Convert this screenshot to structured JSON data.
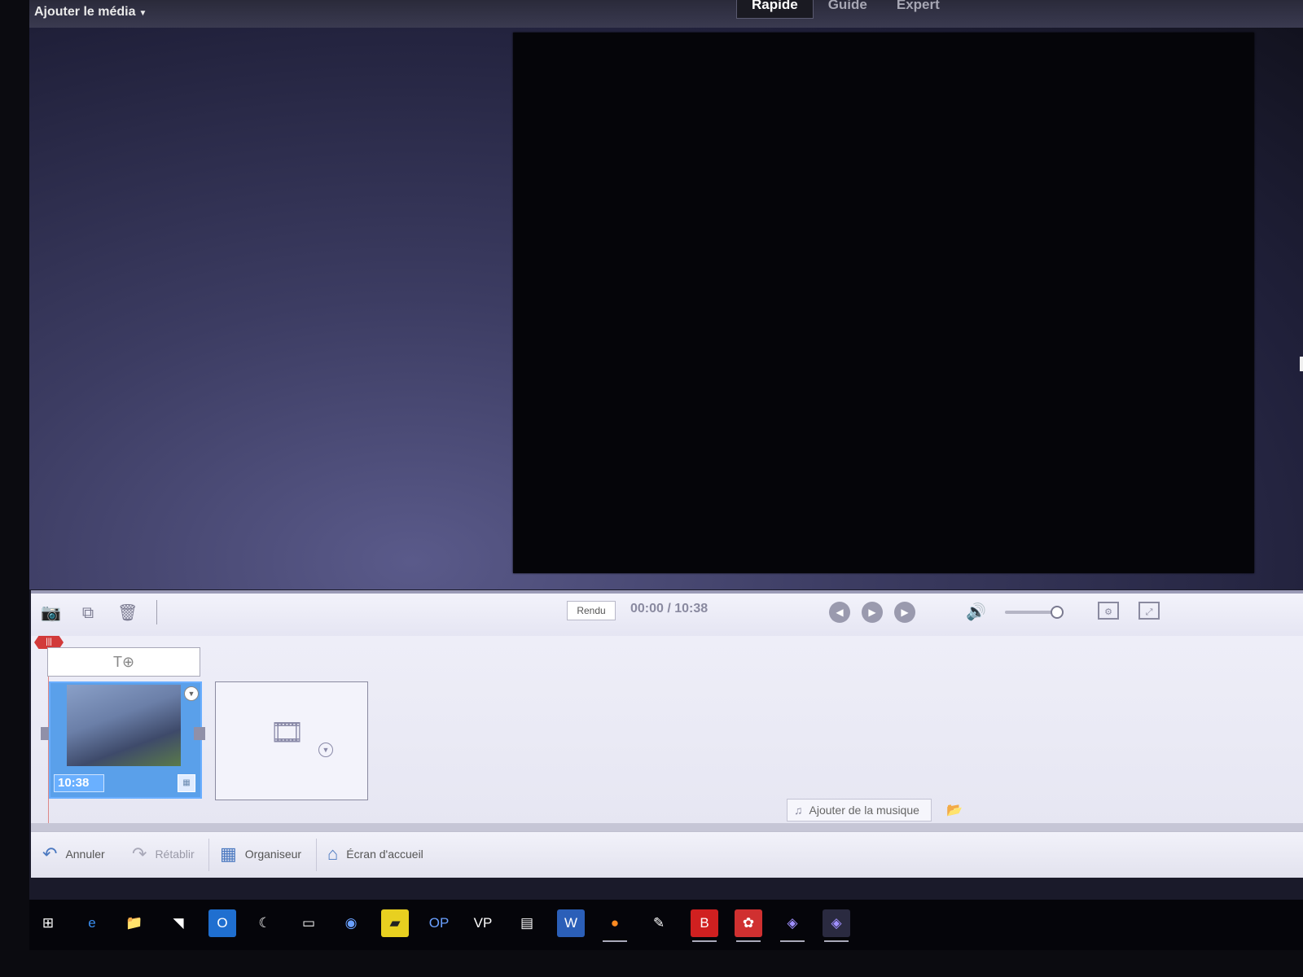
{
  "topbar": {
    "add_media_label": "Ajouter le média",
    "modes": [
      {
        "label": "Rapide",
        "active": true
      },
      {
        "label": "Guide",
        "active": false
      },
      {
        "label": "Expert",
        "active": false
      }
    ]
  },
  "controls": {
    "render_label": "Rendu",
    "timecode": "00:00 / 10:38"
  },
  "timeline": {
    "title_slot_glyph": "T⊕",
    "clip_duration": "10:38",
    "music_button_label": "Ajouter de la musique"
  },
  "actions": {
    "undo_label": "Annuler",
    "redo_label": "Rétablir",
    "organizer_label": "Organiseur",
    "home_label": "Écran d'accueil"
  },
  "taskbar": {
    "items": [
      "start",
      "edge",
      "explorer",
      "app",
      "outlook",
      "app",
      "app",
      "app",
      "sticky-notes",
      "OP",
      "VP",
      "app",
      "W",
      "firefox",
      "app",
      "B",
      "app",
      "app",
      "app"
    ]
  },
  "colors": {
    "playhead": "#d23a3a",
    "clip": "#5aa0ea",
    "accent": "#4a78c0"
  }
}
